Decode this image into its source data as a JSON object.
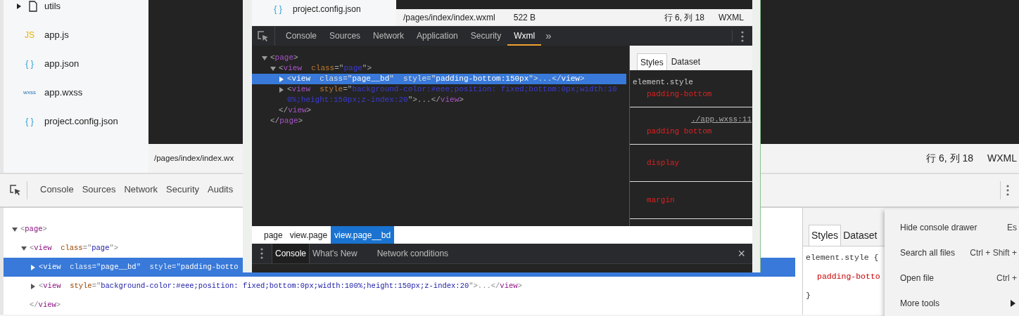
{
  "file_tree": [
    {
      "name": "utils",
      "kind": "folder",
      "expanded": false
    },
    {
      "name": "app.js",
      "kind": "js",
      "icon_text": "JS"
    },
    {
      "name": "app.json",
      "kind": "json",
      "icon_text": "{ }"
    },
    {
      "name": "app.wxss",
      "kind": "wxss",
      "icon_text": "wxss"
    },
    {
      "name": "project.config.json",
      "kind": "json",
      "icon_text": "{ }"
    }
  ],
  "status_bar": {
    "path": "/pages/index/index.wx",
    "position": "行 6, 列 18",
    "language": "WXML"
  },
  "devtools": {
    "tabs": [
      {
        "label": "Console",
        "selected": false
      },
      {
        "label": "Sources",
        "selected": false
      },
      {
        "label": "Network",
        "selected": false
      },
      {
        "label": "Security",
        "selected": false
      },
      {
        "label": "Audits",
        "selected": false
      }
    ],
    "tree": [
      {
        "open": [
          {
            "kind": "punct",
            "text": "<"
          },
          {
            "kind": "tag",
            "text": "page"
          },
          {
            "kind": "punct",
            "text": ">"
          }
        ],
        "expanded": true,
        "selected": false,
        "children": [
          {
            "open": [
              {
                "kind": "punct",
                "text": "<"
              },
              {
                "kind": "tag",
                "text": "view"
              },
              {
                "kind": "attr",
                "text": "  class"
              },
              {
                "kind": "punct",
                "text": "=\""
              },
              {
                "kind": "value",
                "text": "page"
              },
              {
                "kind": "punct",
                "text": "\">"
              }
            ],
            "expanded": true,
            "selected": false,
            "children": [
              {
                "open": [
                  {
                    "kind": "punct",
                    "text": "<"
                  },
                  {
                    "kind": "tag",
                    "text": "view"
                  },
                  {
                    "kind": "attr",
                    "text": "  class"
                  },
                  {
                    "kind": "punct",
                    "text": "=\""
                  },
                  {
                    "kind": "value",
                    "text": "page__bd"
                  },
                  {
                    "kind": "punct",
                    "text": "\""
                  },
                  {
                    "kind": "attr",
                    "text": "  style"
                  },
                  {
                    "kind": "punct",
                    "text": "=\""
                  },
                  {
                    "kind": "value",
                    "text": "padding-botto"
                  }
                ],
                "expanded": false,
                "selected": true
              },
              {
                "open": [
                  {
                    "kind": "punct",
                    "text": "<"
                  },
                  {
                    "kind": "tag",
                    "text": "view"
                  },
                  {
                    "kind": "attr",
                    "text": "  style"
                  },
                  {
                    "kind": "punct",
                    "text": "=\""
                  },
                  {
                    "kind": "value",
                    "text": "background-color:#eee;position: fixed;bottom:0px;width:100%;height:150px;z-index:20"
                  },
                  {
                    "kind": "punct",
                    "text": "\">...</"
                  },
                  {
                    "kind": "tag",
                    "text": "view"
                  },
                  {
                    "kind": "punct",
                    "text": ">"
                  }
                ],
                "expanded": false,
                "selected": false
              }
            ],
            "close": [
              {
                "kind": "punct",
                "text": "</"
              },
              {
                "kind": "tag",
                "text": "view"
              },
              {
                "kind": "punct",
                "text": ">"
              }
            ]
          }
        ]
      }
    ],
    "styles_tabs": [
      {
        "label": "Styles",
        "selected": true
      },
      {
        "label": "Dataset",
        "selected": false
      }
    ],
    "styles_lines": [
      {
        "kind": "selector",
        "text": "element.style {"
      },
      {
        "kind": "property",
        "text": "padding-botto"
      },
      {
        "kind": "brace",
        "text": "}"
      }
    ]
  },
  "context_menu": [
    {
      "label": "Hide console drawer",
      "shortcut": "Es",
      "has_submenu": false
    },
    {
      "label": "Search all files",
      "shortcut": "Ctrl + Shift +",
      "has_submenu": false
    },
    {
      "label": "Open file",
      "shortcut": "Ctrl +",
      "has_submenu": false
    },
    {
      "label": "More tools",
      "has_submenu": true
    }
  ],
  "overlay_screenshot": {
    "file_tree": [
      {
        "name": "project.config.json",
        "kind": "json",
        "icon_text": "{ }"
      }
    ],
    "status_bar": {
      "path": "/pages/index/index.wxml",
      "size": "522 B",
      "position": "行 6, 列 18",
      "language": "WXML"
    },
    "devtools": {
      "tabs": [
        {
          "label": "Console",
          "selected": false
        },
        {
          "label": "Sources",
          "selected": false
        },
        {
          "label": "Network",
          "selected": false
        },
        {
          "label": "Application",
          "selected": false
        },
        {
          "label": "Security",
          "selected": false
        },
        {
          "label": "Wxml",
          "selected": true
        }
      ],
      "more_tabs": "»",
      "tree": [
        {
          "open": [
            {
              "kind": "punct",
              "text": "<"
            },
            {
              "kind": "tag",
              "text": "page"
            },
            {
              "kind": "punct",
              "text": ">"
            }
          ],
          "expanded": true,
          "selected": false,
          "children": [
            {
              "open": [
                {
                  "kind": "punct",
                  "text": "<"
                },
                {
                  "kind": "tag",
                  "text": "view"
                },
                {
                  "kind": "attr",
                  "text": "  class"
                },
                {
                  "kind": "punct",
                  "text": "=\""
                },
                {
                  "kind": "value",
                  "text": "page"
                },
                {
                  "kind": "punct",
                  "text": "\">"
                }
              ],
              "expanded": true,
              "selected": false,
              "children": [
                {
                  "open": [
                    {
                      "kind": "punct",
                      "text": "<"
                    },
                    {
                      "kind": "tag",
                      "text": "view"
                    },
                    {
                      "kind": "attr",
                      "text": "  class"
                    },
                    {
                      "kind": "punct",
                      "text": "=\""
                    },
                    {
                      "kind": "value",
                      "text": "page__bd"
                    },
                    {
                      "kind": "punct",
                      "text": "\""
                    },
                    {
                      "kind": "attr",
                      "text": "  style"
                    },
                    {
                      "kind": "punct",
                      "text": "=\""
                    },
                    {
                      "kind": "value",
                      "text": "padding-bottom:150px"
                    },
                    {
                      "kind": "punct",
                      "text": "\">...</"
                    },
                    {
                      "kind": "tag",
                      "text": "view"
                    },
                    {
                      "kind": "punct",
                      "text": ">"
                    }
                  ],
                  "expanded": false,
                  "selected": true
                },
                {
                  "open": [
                    {
                      "kind": "punct",
                      "text": "<"
                    },
                    {
                      "kind": "tag",
                      "text": "view"
                    },
                    {
                      "kind": "attr",
                      "text": "  style"
                    },
                    {
                      "kind": "punct",
                      "text": "=\""
                    },
                    {
                      "kind": "value",
                      "text": "background-color:#eee;position: fixed;bottom:0px;width:100%;height:150px;z-index:20"
                    },
                    {
                      "kind": "punct",
                      "text": "\">...</"
                    },
                    {
                      "kind": "tag",
                      "text": "view"
                    },
                    {
                      "kind": "punct",
                      "text": ">"
                    }
                  ],
                  "expanded": false,
                  "selected": false
                }
              ],
              "close": [
                {
                  "kind": "punct",
                  "text": "</"
                },
                {
                  "kind": "tag",
                  "text": "view"
                },
                {
                  "kind": "punct",
                  "text": ">"
                }
              ]
            }
          ],
          "close": [
            {
              "kind": "punct",
              "text": "</"
            },
            {
              "kind": "tag",
              "text": "page"
            },
            {
              "kind": "punct",
              "text": ">"
            }
          ]
        }
      ],
      "styles_tabs": [
        {
          "label": "Styles",
          "selected": true
        },
        {
          "label": "Dataset",
          "selected": false
        }
      ],
      "style_sections": [
        {
          "selector": "element.style",
          "properties": [
            "padding-bottom"
          ]
        },
        {
          "source": "./app.wxss:11",
          "properties": [
            "padding bottom"
          ]
        },
        {
          "properties": [
            "display"
          ]
        },
        {
          "properties": [
            "margin"
          ]
        }
      ]
    },
    "breadcrumbs": [
      {
        "label": "page",
        "selected": false
      },
      {
        "label": "view.page",
        "selected": false
      },
      {
        "label": "view.page__bd",
        "selected": true
      }
    ],
    "drawer": {
      "tabs": [
        {
          "label": "Console",
          "selected": true
        },
        {
          "label": "What's New",
          "selected": false
        },
        {
          "label": "Network conditions",
          "selected": false
        }
      ],
      "close": "×"
    }
  }
}
